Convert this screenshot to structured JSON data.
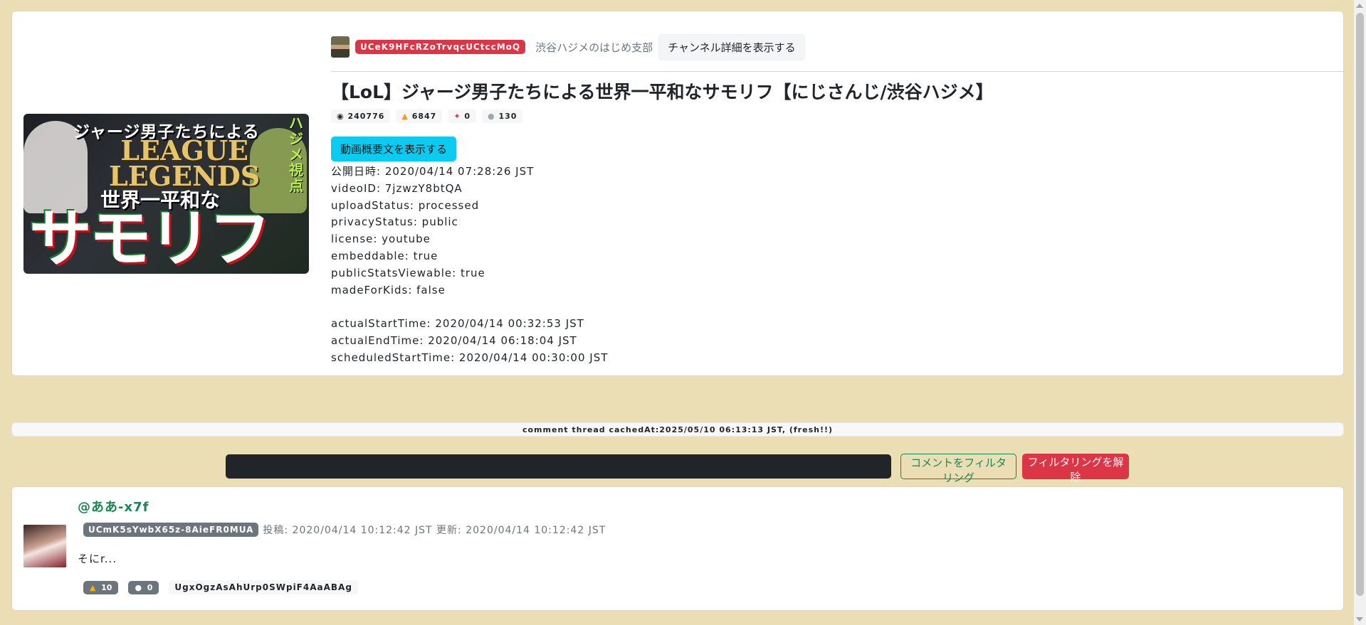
{
  "video": {
    "channel_id": "UCeK9HFcRZoTrvqcUCtccMoQ",
    "channel_name": "渋谷ハジメのはじめ支部",
    "channel_detail_button": "チャンネル詳細を表示する",
    "title": "【LoL】ジャージ男子たちによる世界一平和なサモリフ【にじさんじ/渋谷ハジメ】",
    "thumbnail_text": {
      "line1": "ジャージ男子たちによる",
      "line2a": "LEAGUE",
      "line2b": "LEGENDS",
      "line3": "世界一平和な",
      "big": "サモリフ",
      "side": "ハジメ視点"
    },
    "stats": {
      "views": "240776",
      "likes": "6847",
      "pins": "0",
      "comments": "130"
    },
    "description_button": "動画概要文を表示する",
    "meta_lines": [
      "公開日時: 2020/04/14 07:28:26 JST",
      "videoID: 7jzwzY8btQA",
      "uploadStatus: processed",
      "privacyStatus: public",
      "license: youtube",
      "embeddable: true",
      "publicStatsViewable: true",
      "madeForKids: false",
      "",
      "actualStartTime: 2020/04/14 00:32:53 JST",
      "actualEndTime: 2020/04/14 06:18:04 JST",
      "scheduledStartTime: 2020/04/14 00:30:00 JST"
    ]
  },
  "cache_status": "comment thread cachedAt:2025/05/10 06:13:13 JST, (fresh!!)",
  "filter": {
    "input_value": "",
    "filter_button": "コメントをフィルタリング",
    "clear_button": "フィルタリングを解除"
  },
  "comment": {
    "user": "@ああ-x7f",
    "channel_id": "UCmK5sYwbX65z-8AieFR0MUA",
    "dates": "投稿: 2020/04/14 10:12:42 JST 更新: 2020/04/14 10:12:42 JST",
    "text": "そにr...",
    "likes": "10",
    "replies": "0",
    "comment_id": "UgxOgzAsAhUrp0SWpiF4AaABAg"
  },
  "icons": {
    "views": "eye-icon",
    "likes": "fire-icon",
    "pins": "pin-icon",
    "comments": "speech-bubble-icon"
  }
}
